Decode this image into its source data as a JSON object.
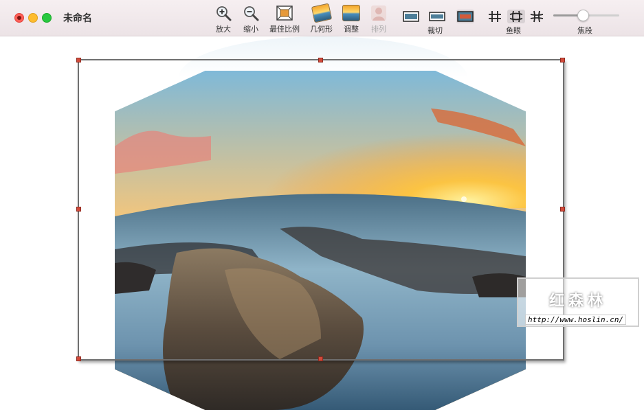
{
  "window": {
    "title": "未命名"
  },
  "toolbar": {
    "zoom_in": "放大",
    "zoom_out": "缩小",
    "best_fit": "最佳比例",
    "geometry": "几何形",
    "adjust": "调整",
    "arrange": "排列",
    "crop_group": "裁切",
    "fisheye_group": "鱼眼",
    "focal_group": "焦段",
    "focal_slider_value": 0.45
  },
  "watermark": {
    "logo": "红森林",
    "url": "http://www.hoslin.cn/"
  }
}
